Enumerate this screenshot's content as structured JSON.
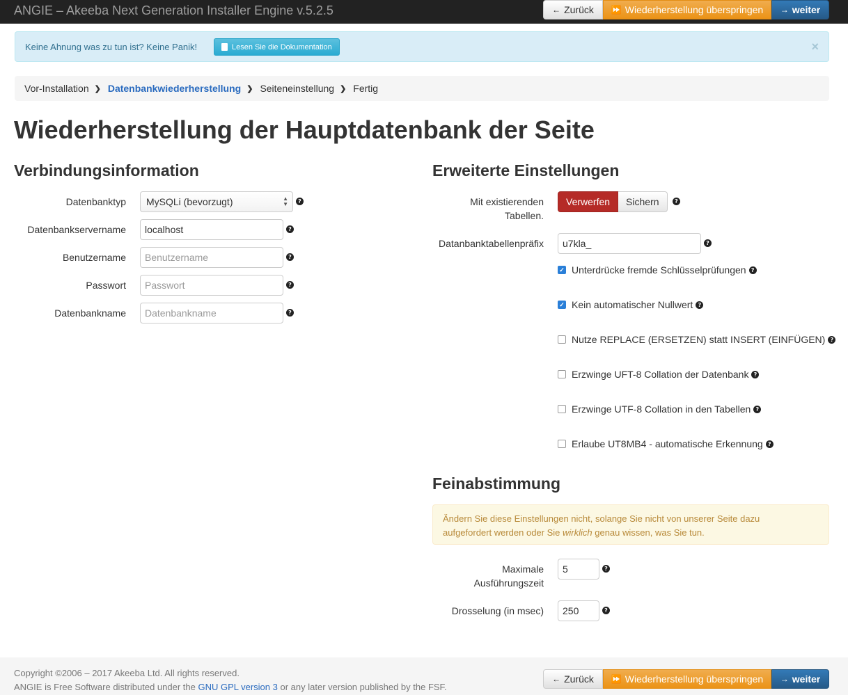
{
  "topbar": {
    "title": "ANGIE – Akeeba Next Generation Installer Engine v.5.2.5",
    "back_label": "Zurück",
    "skip_label": "Wiederherstellung überspringen",
    "next_label": "weiter"
  },
  "info_alert": {
    "text": "Keine Ahnung was zu tun ist? Keine Panik!",
    "docs_button": "Lesen Sie die Dokumentation",
    "close": "×"
  },
  "breadcrumb": {
    "items": [
      "Vor-Installation",
      "Datenbankwiederherstellung",
      "Seiteneinstellung",
      "Fertig"
    ],
    "active_index": 1
  },
  "page_title": "Wiederherstellung der Hauptdatenbank der Seite",
  "connection": {
    "heading": "Verbindungsinformation",
    "db_type_label": "Datenbanktyp",
    "db_type_value": "MySQLi (bevorzugt)",
    "server_label": "Datenbankservername",
    "server_value": "localhost",
    "user_label": "Benutzername",
    "user_placeholder": "Benutzername",
    "password_label": "Passwort",
    "password_placeholder": "Passwort",
    "dbname_label": "Datenbankname",
    "dbname_placeholder": "Datenbankname"
  },
  "advanced": {
    "heading": "Erweiterte Einstellungen",
    "existing_label_1": "Mit existierenden",
    "existing_label_2": "Tabellen.",
    "existing_options": [
      "Verwerfen",
      "Sichern"
    ],
    "existing_selected": "Verwerfen",
    "prefix_label": "Datanbanktabellenpräfix",
    "prefix_value": "u7kla_",
    "checkboxes": [
      {
        "label": "Unterdrücke fremde Schlüsselprüfungen",
        "checked": true
      },
      {
        "label": "Kein automatischer Nullwert",
        "checked": true
      },
      {
        "label": "Nutze REPLACE (ERSETZEN) statt INSERT (EINFÜGEN)",
        "checked": false
      },
      {
        "label": "Erzwinge UFT-8 Collation der Datenbank",
        "checked": false
      },
      {
        "label": "Erzwinge UTF-8 Collation in den Tabellen",
        "checked": false
      },
      {
        "label": "Erlaube UT8MB4 - automatische Erkennung",
        "checked": false
      }
    ]
  },
  "fine_tuning": {
    "heading": "Feinabstimmung",
    "warning_1": "Ändern Sie diese Einstellungen nicht, solange Sie nicht von unserer Seite dazu",
    "warning_2a": "aufgefordert werden oder Sie ",
    "warning_2b": "wirklich",
    "warning_2c": " genau wissen, was Sie tun.",
    "max_exec_label_1": "Maximale",
    "max_exec_label_2": "Ausführungszeit",
    "max_exec_value": "5",
    "throttle_label": "Drosselung (in msec)",
    "throttle_value": "250"
  },
  "footer": {
    "line1": "Copyright ©2006 – 2017 Akeeba Ltd. All rights reserved.",
    "line2_a": "ANGIE is Free Software distributed under the ",
    "line2_link": "GNU GPL version 3",
    "line2_b": " or any later version published by the FSF.",
    "back_label": "Zurück",
    "skip_label": "Wiederherstellung überspringen",
    "next_label": "weiter"
  },
  "colors": {
    "navbar": "#222222",
    "primary": "#337ab7",
    "warning": "#f0ad4e",
    "danger": "#b52b27",
    "info_bg": "#d9edf7",
    "link": "#2a6bbf"
  },
  "icons": [
    "arrow-left-icon",
    "fast-forward-icon",
    "arrow-right-icon",
    "book-icon",
    "question-circle-icon",
    "chevron-right-icon",
    "close-icon"
  ]
}
